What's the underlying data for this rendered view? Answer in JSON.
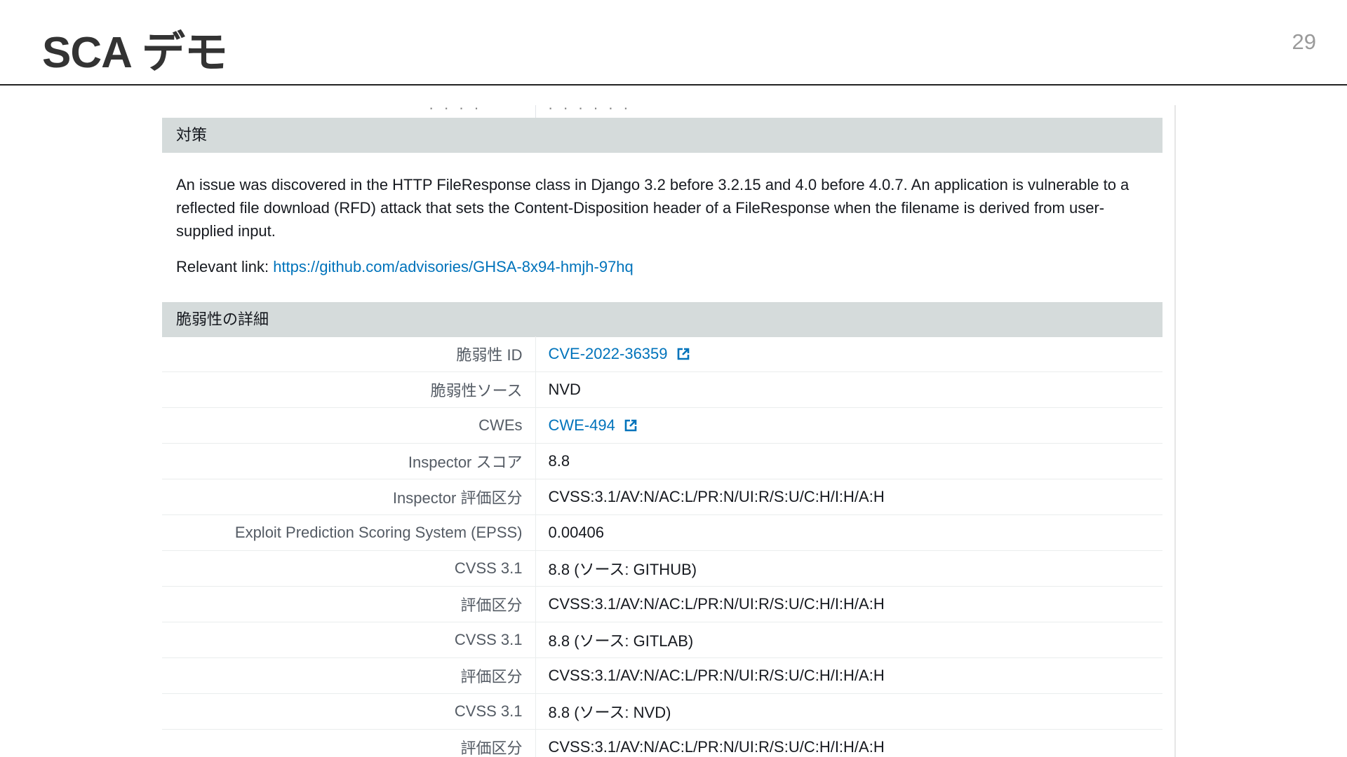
{
  "slide": {
    "title": "SCA デモ",
    "page_number": "29"
  },
  "remediation": {
    "header": "対策",
    "description": "An issue was discovered in the HTTP FileResponse class in Django 3.2 before 3.2.15 and 4.0 before 4.0.7. An application is vulnerable to a reflected file download (RFD) attack that sets the Content-Disposition header of a FileResponse when the filename is derived from user-supplied input.",
    "relevant_label": "Relevant link:",
    "relevant_url": "https://github.com/advisories/GHSA-8x94-hmjh-97hq"
  },
  "details": {
    "header": "脆弱性の詳細",
    "rows": [
      {
        "label": "脆弱性 ID",
        "value": "CVE-2022-36359",
        "link": true
      },
      {
        "label": "脆弱性ソース",
        "value": "NVD",
        "link": false
      },
      {
        "label": "CWEs",
        "value": "CWE-494",
        "link": true
      },
      {
        "label": "Inspector スコア",
        "value": "8.8",
        "link": false
      },
      {
        "label": "Inspector 評価区分",
        "value": "CVSS:3.1/AV:N/AC:L/PR:N/UI:R/S:U/C:H/I:H/A:H",
        "link": false
      },
      {
        "label": "Exploit Prediction Scoring System (EPSS)",
        "value": "0.00406",
        "link": false
      },
      {
        "label": "CVSS 3.1",
        "value": "8.8 (ソース: GITHUB)",
        "link": false
      },
      {
        "label": "評価区分",
        "value": "CVSS:3.1/AV:N/AC:L/PR:N/UI:R/S:U/C:H/I:H/A:H",
        "link": false
      },
      {
        "label": "CVSS 3.1",
        "value": "8.8 (ソース: GITLAB)",
        "link": false
      },
      {
        "label": "評価区分",
        "value": "CVSS:3.1/AV:N/AC:L/PR:N/UI:R/S:U/C:H/I:H/A:H",
        "link": false
      },
      {
        "label": "CVSS 3.1",
        "value": "8.8 (ソース: NVD)",
        "link": false
      },
      {
        "label": "評価区分",
        "value": "CVSS:3.1/AV:N/AC:L/PR:N/UI:R/S:U/C:H/I:H/A:H",
        "link": false
      }
    ]
  },
  "colors": {
    "link": "#0073bb",
    "header_bg": "#d5dbdb",
    "label": "#545b64"
  }
}
